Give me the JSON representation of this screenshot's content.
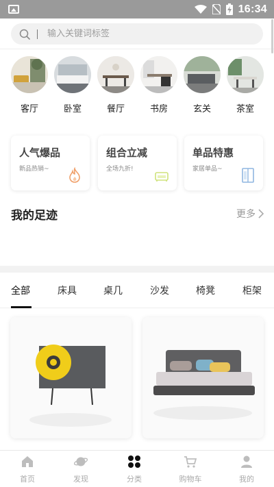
{
  "status_bar": {
    "time": "16:34"
  },
  "search": {
    "placeholder": "输入关键词标签"
  },
  "rooms": [
    {
      "label": "客厅"
    },
    {
      "label": "卧室"
    },
    {
      "label": "餐厅"
    },
    {
      "label": "书房"
    },
    {
      "label": "玄关"
    },
    {
      "label": "茶室"
    }
  ],
  "promos": [
    {
      "title": "人气爆品",
      "subtitle": "新品热销~",
      "icon": "flame-icon"
    },
    {
      "title": "组合立减",
      "subtitle": "全场九折!",
      "icon": "sofa-icon"
    },
    {
      "title": "单品特惠",
      "subtitle": "家居单品~",
      "icon": "cabinet-icon"
    }
  ],
  "footprints": {
    "title": "我的足迹",
    "more": "更多"
  },
  "category_tabs": [
    {
      "label": "全部",
      "active": true
    },
    {
      "label": "床具"
    },
    {
      "label": "桌几"
    },
    {
      "label": "沙发"
    },
    {
      "label": "椅凳"
    },
    {
      "label": "柜架"
    }
  ],
  "bottom_nav": [
    {
      "label": "首页",
      "icon": "home-icon"
    },
    {
      "label": "发现",
      "icon": "planet-icon"
    },
    {
      "label": "分类",
      "icon": "grid-icon",
      "active": true
    },
    {
      "label": "购物车",
      "icon": "cart-icon"
    },
    {
      "label": "我的",
      "icon": "user-icon"
    }
  ],
  "colors": {
    "accent_dark": "#111111",
    "promo_icon_orange": "#f0a06a",
    "promo_icon_green": "#cfe27a",
    "promo_icon_blue": "#8fb6e0"
  }
}
